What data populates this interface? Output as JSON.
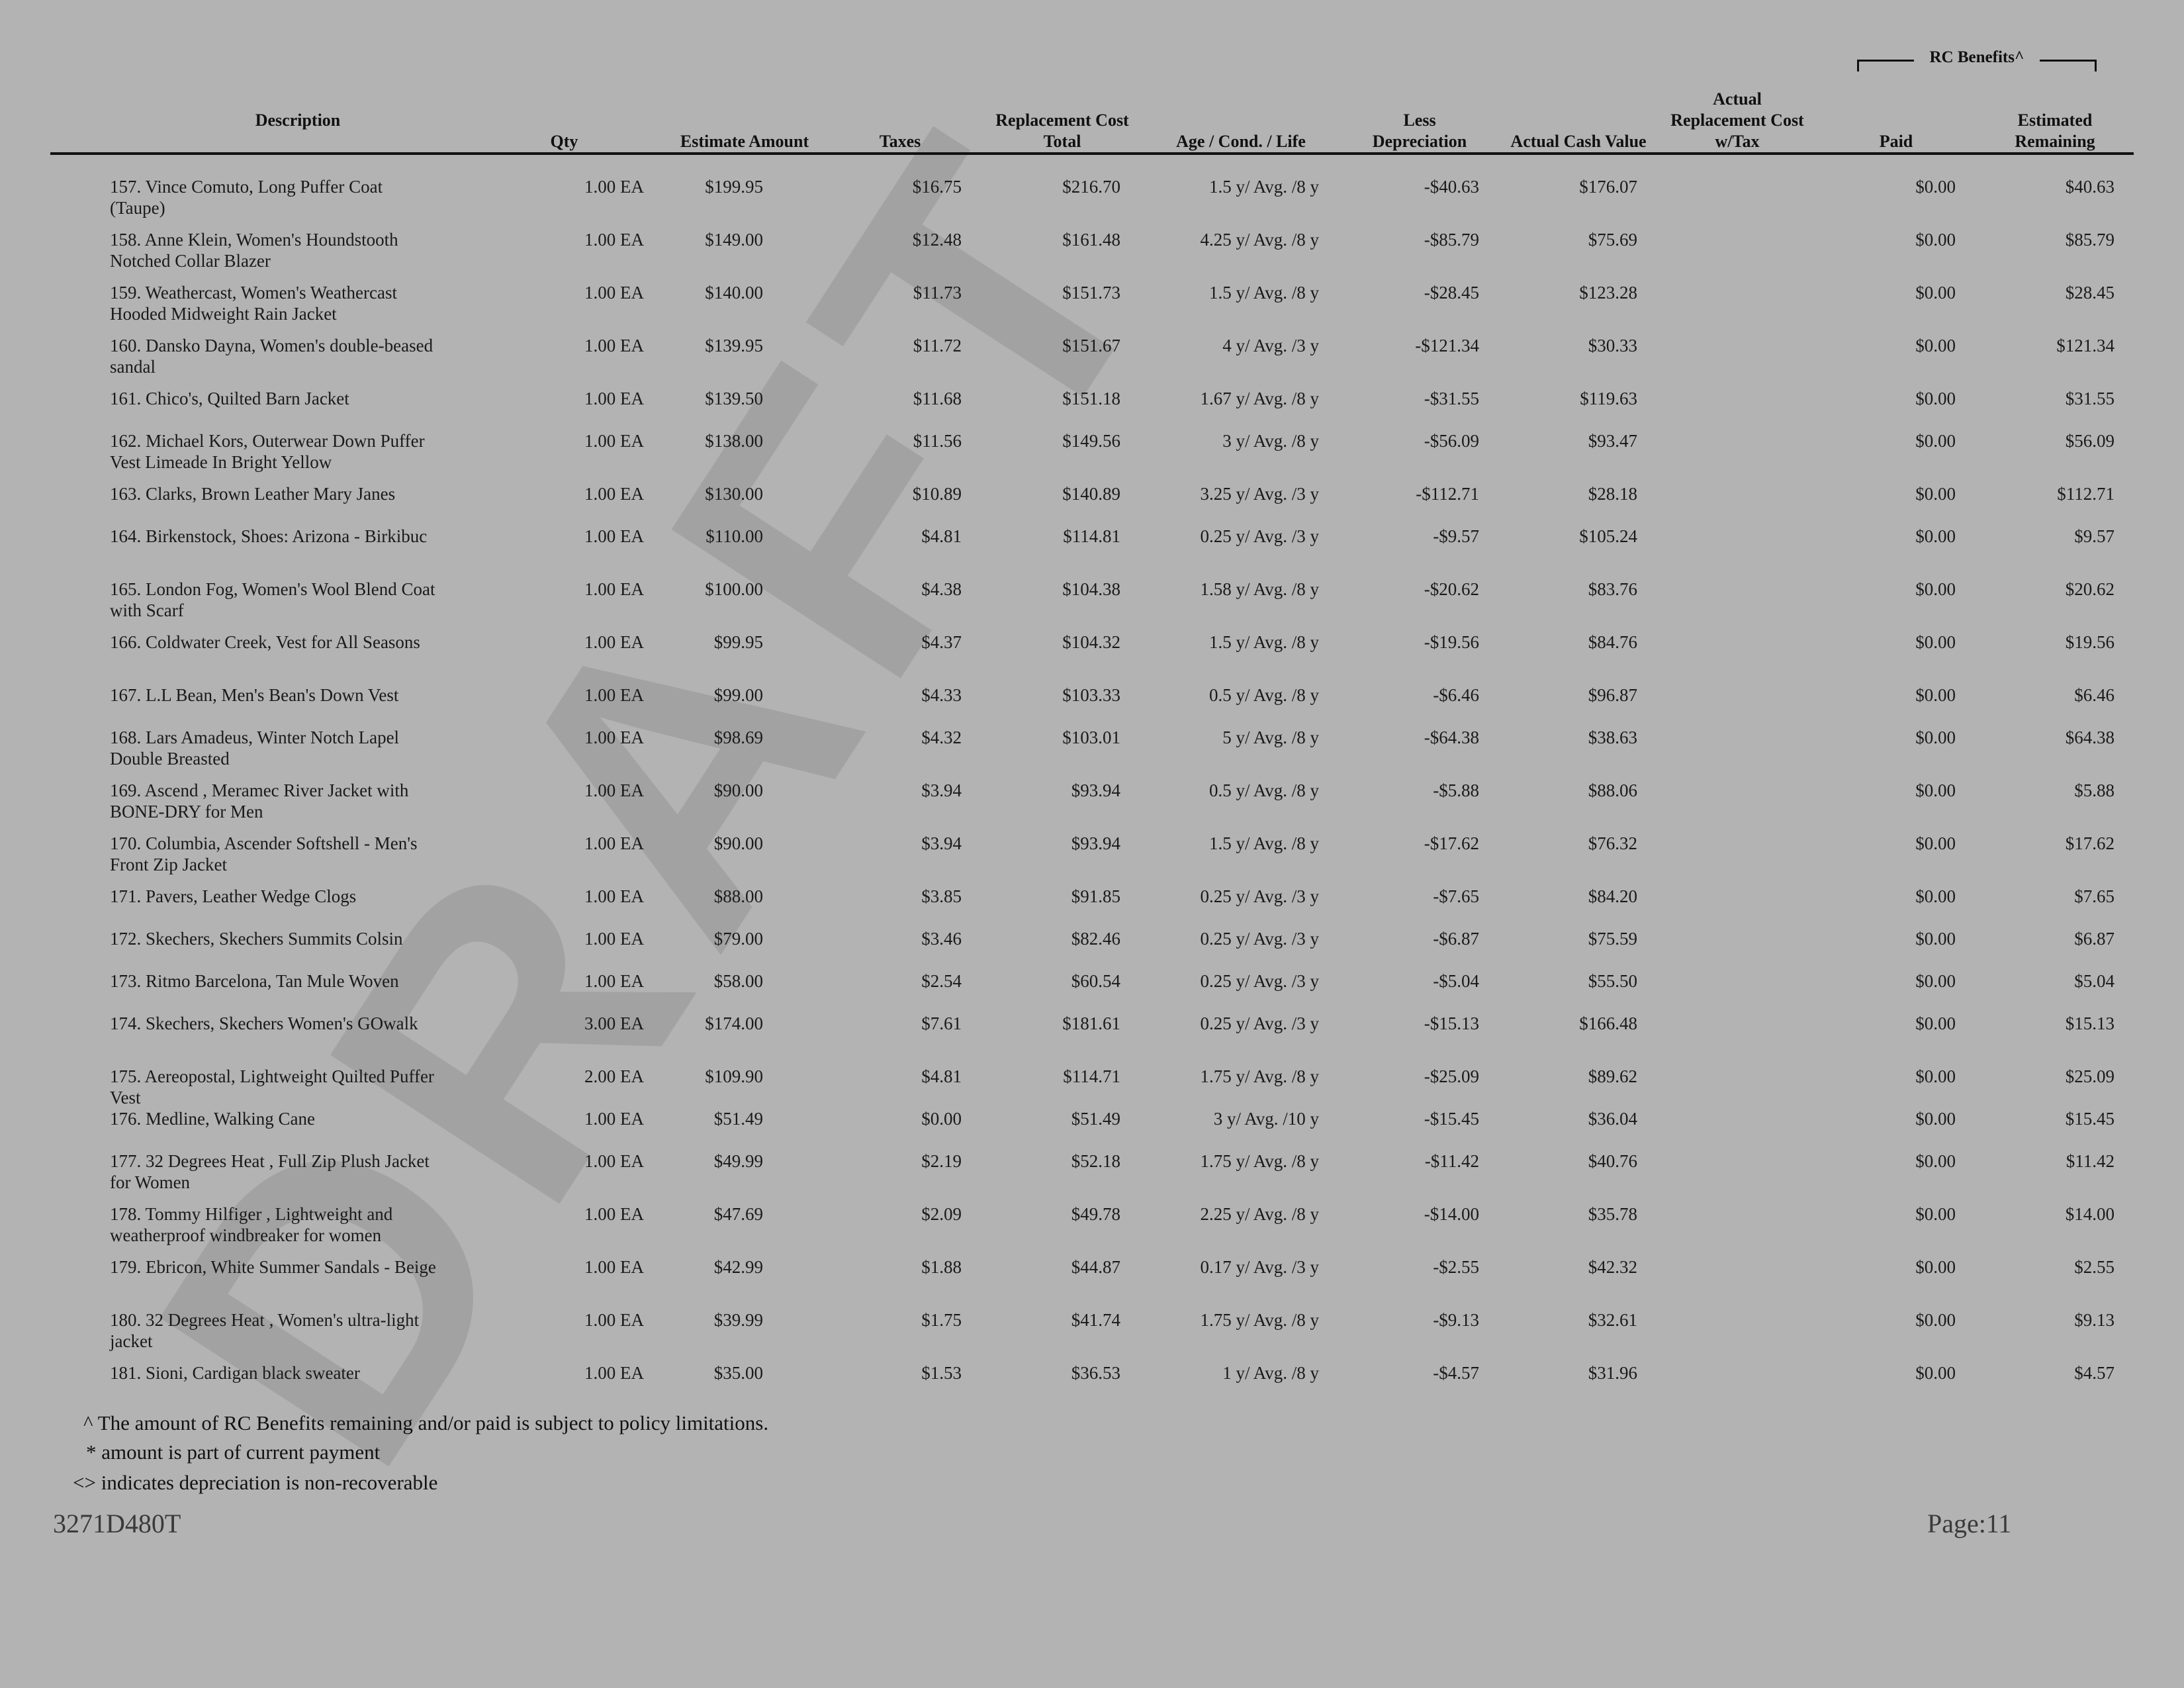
{
  "headers": {
    "description": "Description",
    "qty": "Qty",
    "estimate_amount": "Estimate Amount",
    "taxes": "Taxes",
    "replacement_cost_total": [
      "Replacement Cost",
      "Total"
    ],
    "age_cond_life": "Age / Cond. / Life",
    "less_depreciation": [
      "Less",
      "Depreciation"
    ],
    "actual_cash_value": "Actual Cash Value",
    "actual_replacement_cost": [
      "Actual",
      "Replacement Cost",
      "w/Tax"
    ],
    "rc_benefits": "RC Benefits^",
    "paid": "Paid",
    "estimated_remaining": [
      "Estimated",
      "Remaining"
    ]
  },
  "rows": [
    {
      "desc": "157. Vince Comuto, Long Puffer Coat (Taupe)",
      "qty": "1.00 EA",
      "est": "$199.95",
      "tax": "$16.75",
      "rct": "$216.70",
      "age": "1.5 y/ Avg. /8 y",
      "dep": "-$40.63",
      "acv": "$176.07",
      "arc": "",
      "paid": "$0.00",
      "rem": "$40.63"
    },
    {
      "desc": "158. Anne Klein, Women's Houndstooth Notched Collar Blazer",
      "qty": "1.00 EA",
      "est": "$149.00",
      "tax": "$12.48",
      "rct": "$161.48",
      "age": "4.25 y/ Avg. /8 y",
      "dep": "-$85.79",
      "acv": "$75.69",
      "arc": "",
      "paid": "$0.00",
      "rem": "$85.79"
    },
    {
      "desc": "159. Weathercast, Women's Weathercast Hooded Midweight Rain Jacket",
      "qty": "1.00 EA",
      "est": "$140.00",
      "tax": "$11.73",
      "rct": "$151.73",
      "age": "1.5 y/ Avg. /8 y",
      "dep": "-$28.45",
      "acv": "$123.28",
      "arc": "",
      "paid": "$0.00",
      "rem": "$28.45"
    },
    {
      "desc": "160. Dansko Dayna,  Women's double-beased sandal",
      "qty": "1.00 EA",
      "est": "$139.95",
      "tax": "$11.72",
      "rct": "$151.67",
      "age": "4 y/ Avg. /3 y",
      "dep": "-$121.34",
      "acv": "$30.33",
      "arc": "",
      "paid": "$0.00",
      "rem": "$121.34"
    },
    {
      "desc": "161. Chico's, Quilted Barn Jacket",
      "qty": "1.00 EA",
      "est": "$139.50",
      "tax": "$11.68",
      "rct": "$151.18",
      "age": "1.67 y/ Avg. /8 y",
      "dep": "-$31.55",
      "acv": "$119.63",
      "arc": "",
      "paid": "$0.00",
      "rem": "$31.55"
    },
    {
      "desc": "162. Michael Kors, Outerwear Down Puffer Vest Limeade In Bright Yellow",
      "qty": "1.00 EA",
      "est": "$138.00",
      "tax": "$11.56",
      "rct": "$149.56",
      "age": "3 y/ Avg. /8 y",
      "dep": "-$56.09",
      "acv": "$93.47",
      "arc": "",
      "paid": "$0.00",
      "rem": "$56.09"
    },
    {
      "desc": "163. Clarks, Brown Leather Mary Janes",
      "qty": "1.00 EA",
      "est": "$130.00",
      "tax": "$10.89",
      "rct": "$140.89",
      "age": "3.25 y/ Avg. /3 y",
      "dep": "-$112.71",
      "acv": "$28.18",
      "arc": "",
      "paid": "$0.00",
      "rem": "$112.71"
    },
    {
      "desc": "164. Birkenstock, Shoes: Arizona - Birkibuc",
      "qty": "1.00 EA",
      "est": "$110.00",
      "tax": "$4.81",
      "rct": "$114.81",
      "age": "0.25 y/ Avg. /3 y",
      "dep": "-$9.57",
      "acv": "$105.24",
      "arc": "",
      "paid": "$0.00",
      "rem": "$9.57"
    },
    {
      "desc": "165. London Fog, Women's Wool Blend Coat with Scarf",
      "qty": "1.00 EA",
      "est": "$100.00",
      "tax": "$4.38",
      "rct": "$104.38",
      "age": "1.58 y/ Avg. /8 y",
      "dep": "-$20.62",
      "acv": "$83.76",
      "arc": "",
      "paid": "$0.00",
      "rem": "$20.62"
    },
    {
      "desc": "166. Coldwater Creek, Vest for All Seasons",
      "qty": "1.00 EA",
      "est": "$99.95",
      "tax": "$4.37",
      "rct": "$104.32",
      "age": "1.5 y/ Avg. /8 y",
      "dep": "-$19.56",
      "acv": "$84.76",
      "arc": "",
      "paid": "$0.00",
      "rem": "$19.56"
    },
    {
      "desc": "167. L.L Bean, Men's Bean's Down Vest",
      "qty": "1.00 EA",
      "est": "$99.00",
      "tax": "$4.33",
      "rct": "$103.33",
      "age": "0.5 y/ Avg. /8 y",
      "dep": "-$6.46",
      "acv": "$96.87",
      "arc": "",
      "paid": "$0.00",
      "rem": "$6.46"
    },
    {
      "desc": "168. Lars Amadeus, Winter Notch Lapel Double Breasted",
      "qty": "1.00 EA",
      "est": "$98.69",
      "tax": "$4.32",
      "rct": "$103.01",
      "age": "5 y/ Avg. /8 y",
      "dep": "-$64.38",
      "acv": "$38.63",
      "arc": "",
      "paid": "$0.00",
      "rem": "$64.38"
    },
    {
      "desc": "169. Ascend , Meramec River Jacket with BONE-DRY for Men",
      "qty": "1.00 EA",
      "est": "$90.00",
      "tax": "$3.94",
      "rct": "$93.94",
      "age": "0.5 y/ Avg. /8 y",
      "dep": "-$5.88",
      "acv": "$88.06",
      "arc": "",
      "paid": "$0.00",
      "rem": "$5.88"
    },
    {
      "desc": "170. Columbia,  Ascender Softshell - Men's Front Zip Jacket",
      "qty": "1.00 EA",
      "est": "$90.00",
      "tax": "$3.94",
      "rct": "$93.94",
      "age": "1.5 y/ Avg. /8 y",
      "dep": "-$17.62",
      "acv": "$76.32",
      "arc": "",
      "paid": "$0.00",
      "rem": "$17.62"
    },
    {
      "desc": "171. Pavers, Leather Wedge Clogs",
      "qty": "1.00 EA",
      "est": "$88.00",
      "tax": "$3.85",
      "rct": "$91.85",
      "age": "0.25 y/ Avg. /3 y",
      "dep": "-$7.65",
      "acv": "$84.20",
      "arc": "",
      "paid": "$0.00",
      "rem": "$7.65"
    },
    {
      "desc": "172. Skechers, Skechers Summits Colsin",
      "qty": "1.00 EA",
      "est": "$79.00",
      "tax": "$3.46",
      "rct": "$82.46",
      "age": "0.25 y/ Avg. /3 y",
      "dep": "-$6.87",
      "acv": "$75.59",
      "arc": "",
      "paid": "$0.00",
      "rem": "$6.87"
    },
    {
      "desc": "173. Ritmo Barcelona, Tan Mule Woven",
      "qty": "1.00 EA",
      "est": "$58.00",
      "tax": "$2.54",
      "rct": "$60.54",
      "age": "0.25 y/ Avg. /3 y",
      "dep": "-$5.04",
      "acv": "$55.50",
      "arc": "",
      "paid": "$0.00",
      "rem": "$5.04"
    },
    {
      "desc": "174. Skechers, Skechers Women's GOwalk",
      "qty": "3.00 EA",
      "est": "$174.00",
      "tax": "$7.61",
      "rct": "$181.61",
      "age": "0.25 y/ Avg. /3 y",
      "dep": "-$15.13",
      "acv": "$166.48",
      "arc": "",
      "paid": "$0.00",
      "rem": "$15.13"
    },
    {
      "desc": "175. Aereopostal, Lightweight Quilted Puffer Vest",
      "qty": "2.00 EA",
      "est": "$109.90",
      "tax": "$4.81",
      "rct": "$114.71",
      "age": "1.75 y/ Avg. /8 y",
      "dep": "-$25.09",
      "acv": "$89.62",
      "arc": "",
      "paid": "$0.00",
      "rem": "$25.09"
    },
    {
      "desc": "176. Medline, Walking Cane",
      "qty": "1.00 EA",
      "est": "$51.49",
      "tax": "$0.00",
      "rct": "$51.49",
      "age": "3 y/ Avg. /10 y",
      "dep": "-$15.45",
      "acv": "$36.04",
      "arc": "",
      "paid": "$0.00",
      "rem": "$15.45"
    },
    {
      "desc": "177. 32 Degrees Heat , Full Zip Plush Jacket for Women",
      "qty": "1.00 EA",
      "est": "$49.99",
      "tax": "$2.19",
      "rct": "$52.18",
      "age": "1.75 y/ Avg. /8 y",
      "dep": "-$11.42",
      "acv": "$40.76",
      "arc": "",
      "paid": "$0.00",
      "rem": "$11.42"
    },
    {
      "desc": "178. Tommy Hilfiger , Lightweight and weatherproof windbreaker for women",
      "qty": "1.00 EA",
      "est": "$47.69",
      "tax": "$2.09",
      "rct": "$49.78",
      "age": "2.25 y/ Avg. /8 y",
      "dep": "-$14.00",
      "acv": "$35.78",
      "arc": "",
      "paid": "$0.00",
      "rem": "$14.00"
    },
    {
      "desc": "179. Ebricon, White Summer Sandals - Beige",
      "qty": "1.00 EA",
      "est": "$42.99",
      "tax": "$1.88",
      "rct": "$44.87",
      "age": "0.17 y/ Avg. /3 y",
      "dep": "-$2.55",
      "acv": "$42.32",
      "arc": "",
      "paid": "$0.00",
      "rem": "$2.55"
    },
    {
      "desc": "180. 32 Degrees Heat , Women's ultra-light jacket",
      "qty": "1.00 EA",
      "est": "$39.99",
      "tax": "$1.75",
      "rct": "$41.74",
      "age": "1.75 y/ Avg. /8 y",
      "dep": "-$9.13",
      "acv": "$32.61",
      "arc": "",
      "paid": "$0.00",
      "rem": "$9.13"
    },
    {
      "desc": "181. Sioni, Cardigan black sweater",
      "qty": "1.00 EA",
      "est": "$35.00",
      "tax": "$1.53",
      "rct": "$36.53",
      "age": "1 y/ Avg. /8 y",
      "dep": "-$4.57",
      "acv": "$31.96",
      "arc": "",
      "paid": "$0.00",
      "rem": "$4.57"
    }
  ],
  "footnotes": {
    "rc_note": "^ The amount of RC Benefits remaining and/or paid is subject to policy limitations.",
    "payment_note": "* amount is part of current payment",
    "depreciation_note": "<> indicates depreciation is non-recoverable"
  },
  "footer": {
    "doc_id": "3271D480T",
    "page": "Page:11"
  },
  "watermark": "DRAFT"
}
